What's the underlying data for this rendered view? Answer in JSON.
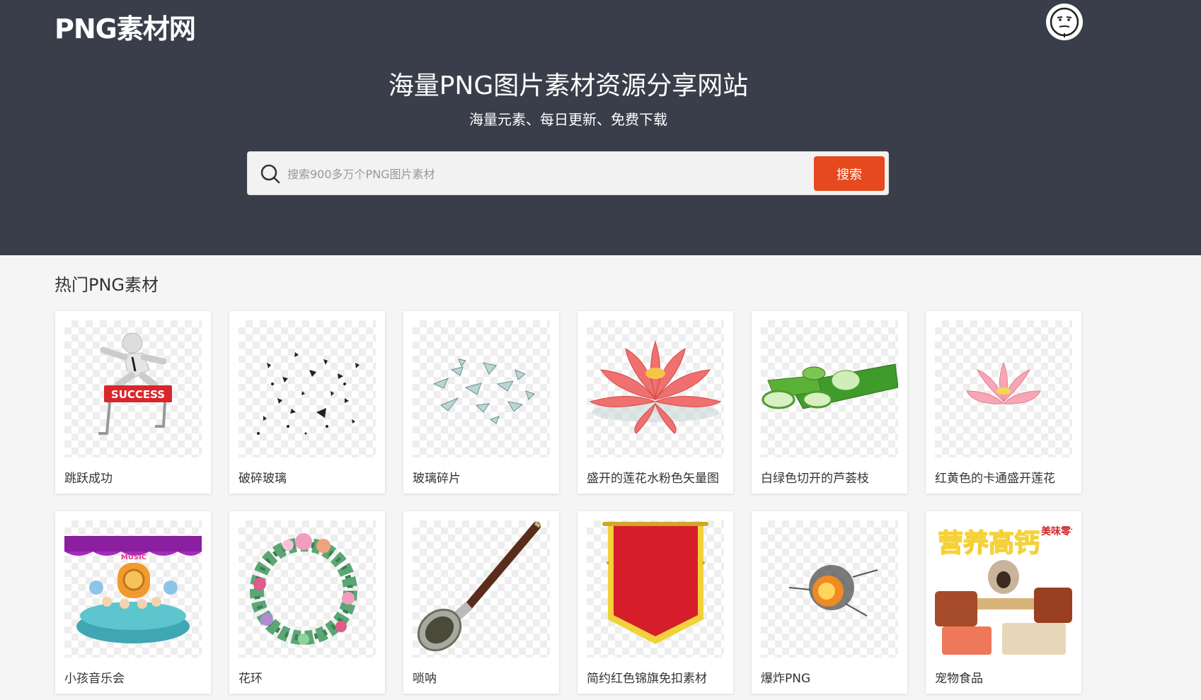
{
  "header": {
    "logo": "PNG素材网",
    "title": "海量PNG图片素材资源分享网站",
    "subtitle": "海量元素、每日更新、免费下载"
  },
  "search": {
    "placeholder": "搜索900多万个PNG图片素材",
    "button_label": "搜索"
  },
  "section": {
    "title": "热门PNG素材"
  },
  "cards": [
    {
      "label": "跳跃成功",
      "icon": "success-hurdle-icon"
    },
    {
      "label": "破碎玻璃",
      "icon": "broken-glass-icon"
    },
    {
      "label": "玻璃碎片",
      "icon": "glass-shards-icon"
    },
    {
      "label": "盛开的莲花水粉色矢量图",
      "icon": "pink-lotus-icon"
    },
    {
      "label": "白绿色切开的芦荟枝",
      "icon": "aloe-vera-icon"
    },
    {
      "label": "红黄色的卡通盛开莲花",
      "icon": "cartoon-lotus-icon"
    },
    {
      "label": "小孩音乐会",
      "icon": "kids-concert-icon"
    },
    {
      "label": "花环",
      "icon": "flower-wreath-icon"
    },
    {
      "label": "唢呐",
      "icon": "suona-icon"
    },
    {
      "label": "简约红色锦旗免扣素材",
      "icon": "red-banner-icon"
    },
    {
      "label": "爆炸PNG",
      "icon": "explosion-icon"
    },
    {
      "label": "宠物食品",
      "icon": "pet-food-icon"
    }
  ],
  "pet_food": {
    "banner_text": "营养高钙",
    "side_text": "美味零食",
    "success_text": "SUCCESS",
    "music_text": "MUSIC"
  }
}
